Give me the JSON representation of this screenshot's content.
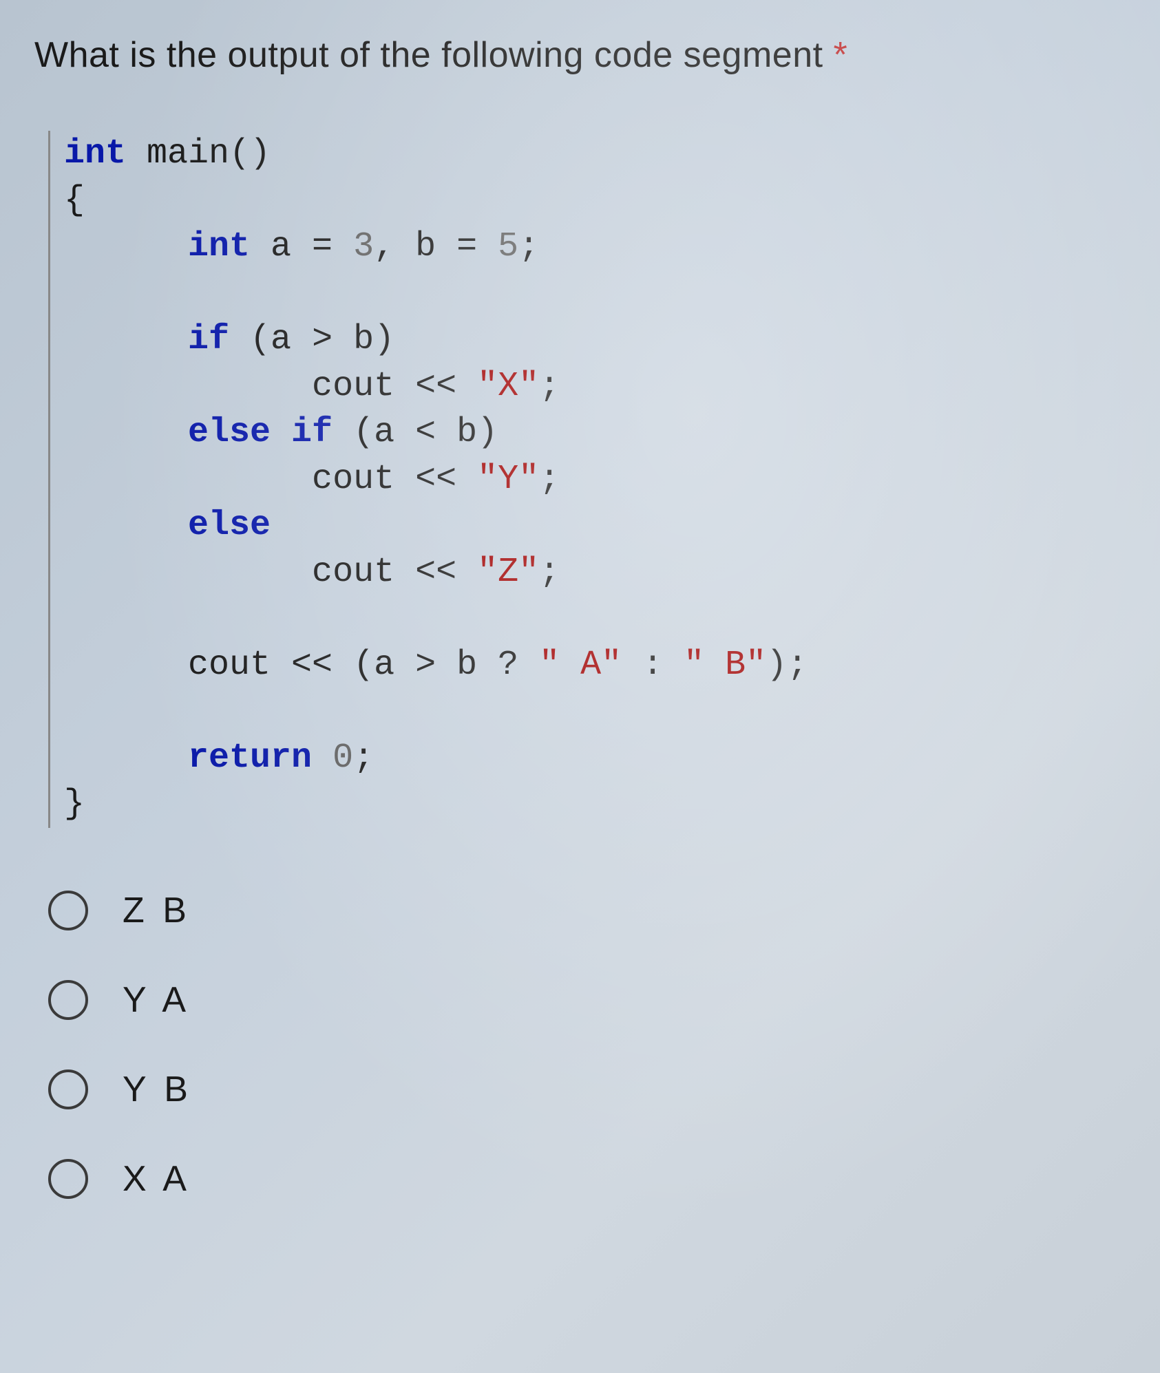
{
  "question": {
    "title": "What is the output of the following code segment",
    "required_marker": "*"
  },
  "code": {
    "l1a": "int",
    "l1b": " main()",
    "l2": "{",
    "l3a": "      ",
    "l3b": "int",
    "l3c": " a = ",
    "l3d": "3",
    "l3e": ", b = ",
    "l3f": "5",
    "l3g": ";",
    "l5a": "      ",
    "l5b": "if",
    "l5c": " (a > b)",
    "l6a": "            cout << ",
    "l6b": "\"X\"",
    "l6c": ";",
    "l7a": "      ",
    "l7b": "else if",
    "l7c": " (a < b)",
    "l8a": "            cout << ",
    "l8b": "\"Y\"",
    "l8c": ";",
    "l9a": "      ",
    "l9b": "else",
    "l10a": "            cout << ",
    "l10b": "\"Z\"",
    "l10c": ";",
    "l12a": "      cout << (a > b ? ",
    "l12b": "\" A\"",
    "l12c": " : ",
    "l12d": "\" B\"",
    "l12e": ");",
    "l14a": "      ",
    "l14b": "return",
    "l14c": " ",
    "l14d": "0",
    "l14e": ";",
    "l15": "}"
  },
  "options": [
    {
      "label": "Z B"
    },
    {
      "label": "Y A"
    },
    {
      "label": "Y B"
    },
    {
      "label": "X A"
    }
  ]
}
